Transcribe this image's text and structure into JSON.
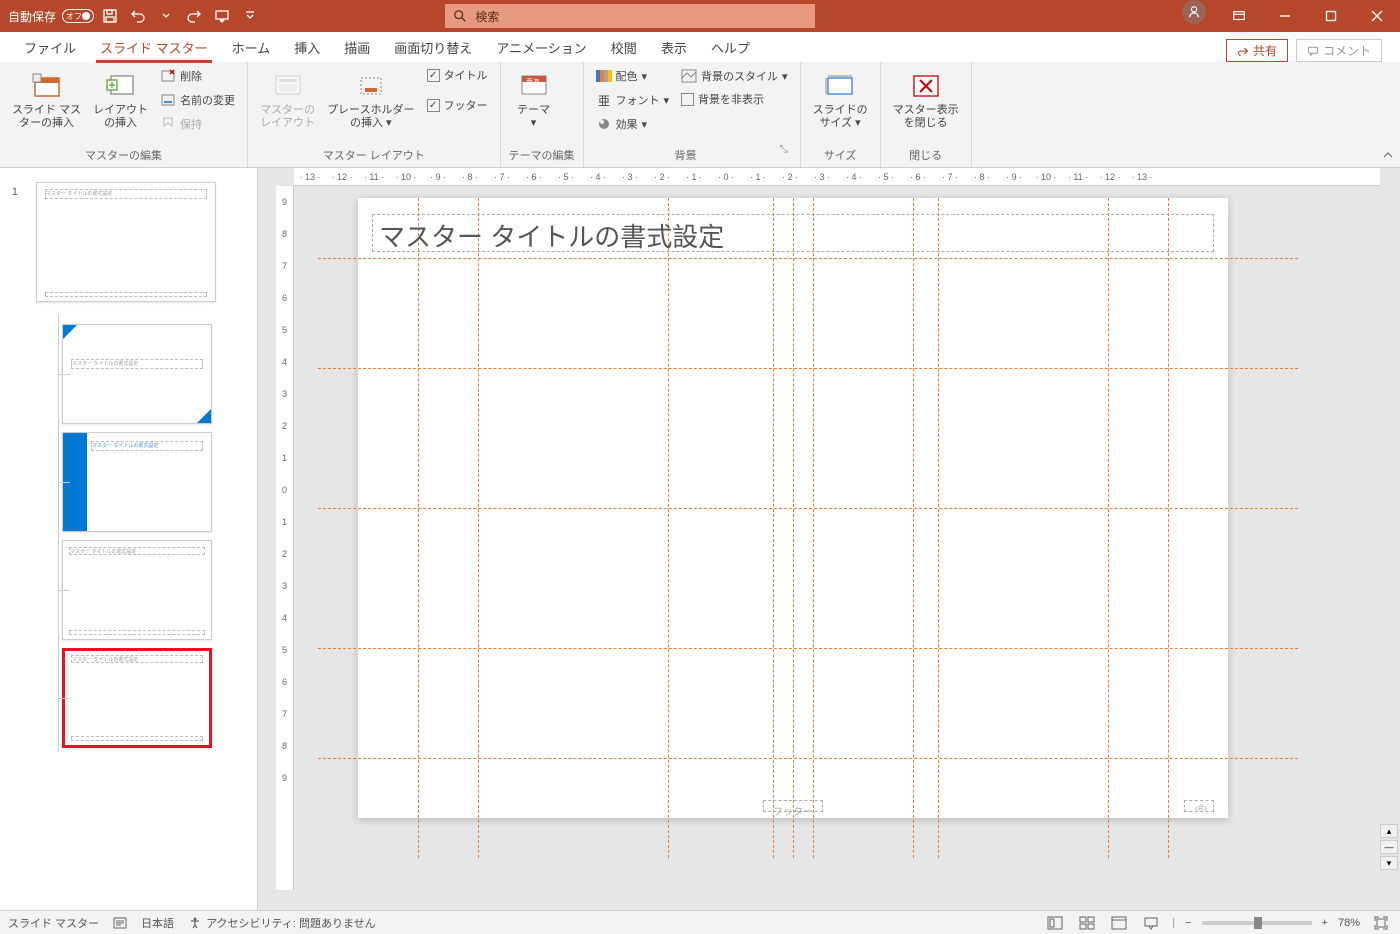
{
  "titlebar": {
    "autosave_label": "自動保存",
    "autosave_state": "オフ",
    "search_placeholder": "検索"
  },
  "tabs": {
    "file": "ファイル",
    "slide_master": "スライド マスター",
    "home": "ホーム",
    "insert": "挿入",
    "draw": "描画",
    "transitions": "画面切り替え",
    "animations": "アニメーション",
    "review": "校閲",
    "view": "表示",
    "help": "ヘルプ",
    "share": "共有",
    "comments": "コメント"
  },
  "ribbon": {
    "edit_master": {
      "label": "マスターの編集",
      "insert_slide_master": "スライド マス\nターの挿入",
      "insert_layout": "レイアウト\nの挿入",
      "delete": "削除",
      "rename": "名前の変更",
      "preserve": "保持"
    },
    "master_layout": {
      "label": "マスター レイアウト",
      "master_layout_btn": "マスターの\nレイアウト",
      "insert_placeholder": "プレースホルダー\nの挿入",
      "title_chk": "タイトル",
      "footer_chk": "フッター"
    },
    "edit_theme": {
      "label": "テーマの編集",
      "themes": "テーマ"
    },
    "background": {
      "label": "背景",
      "colors": "配色",
      "fonts": "フォント",
      "effects": "効果",
      "bg_styles": "背景のスタイル",
      "hide_bg": "背景を非表示"
    },
    "size": {
      "label": "サイズ",
      "slide_size": "スライドの\nサイズ"
    },
    "close": {
      "label": "閉じる",
      "close_master": "マスター表示\nを閉じる"
    }
  },
  "slide": {
    "title_placeholder": "マスター タイトルの書式設定",
    "footer_placeholder": "フッター",
    "number_placeholder": "‹#›"
  },
  "thumbnails": {
    "index": "1",
    "mini_title": "マスター タイトルの書式設定"
  },
  "ruler_h": [
    "13",
    "12",
    "11",
    "10",
    "9",
    "8",
    "7",
    "6",
    "5",
    "4",
    "3",
    "2",
    "1",
    "0",
    "1",
    "2",
    "3",
    "4",
    "5",
    "6",
    "7",
    "8",
    "9",
    "10",
    "11",
    "12",
    "13"
  ],
  "ruler_v": [
    "9",
    "8",
    "7",
    "6",
    "5",
    "4",
    "3",
    "2",
    "1",
    "0",
    "1",
    "2",
    "3",
    "4",
    "5",
    "6",
    "7",
    "8",
    "9"
  ],
  "statusbar": {
    "view_label": "スライド マスター",
    "language": "日本語",
    "accessibility": "アクセシビリティ: 問題ありません",
    "zoom": "78%"
  }
}
